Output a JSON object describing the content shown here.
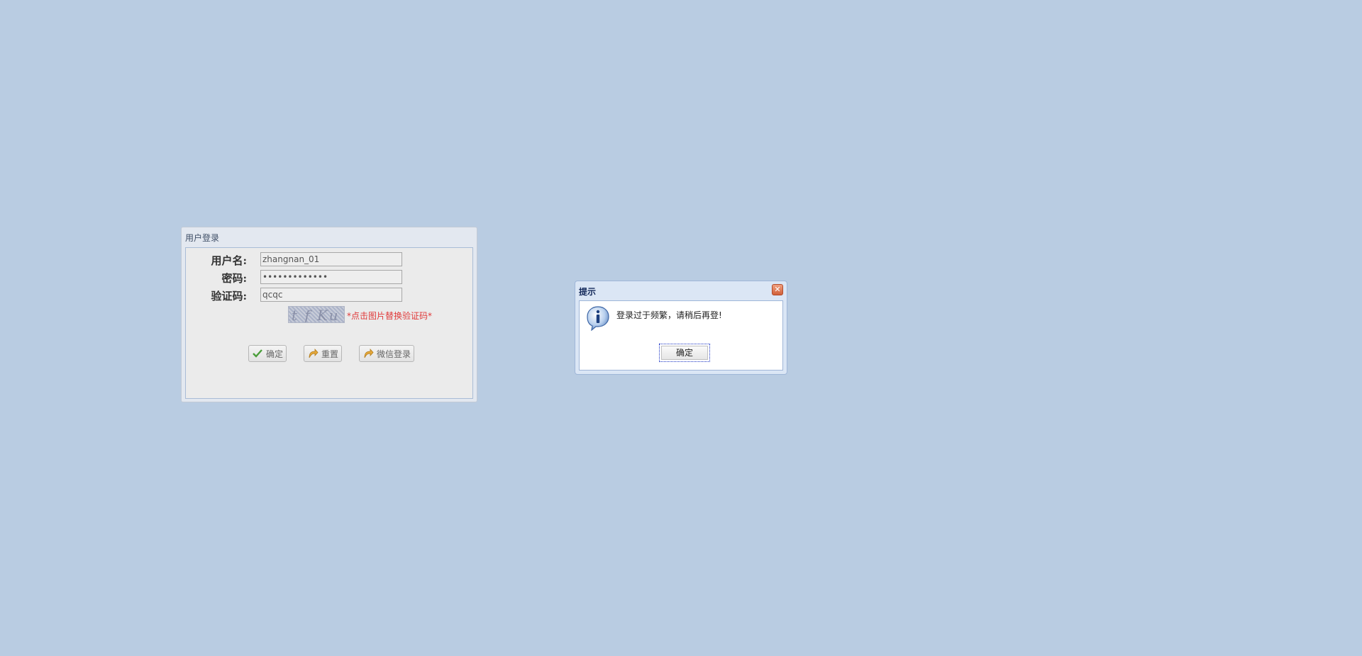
{
  "colors": {
    "background": "#b9cce2",
    "captcha_hint": "#e03a3a",
    "dialog_title": "#14295a"
  },
  "login": {
    "title": "用户登录",
    "username_label": "用户名:",
    "username_value": "zhangnan_01",
    "password_label": "密码:",
    "password_value": "•••••••••••••",
    "captcha_label": "验证码:",
    "captcha_value": "qcqc",
    "captcha_image_text": "t f Ku",
    "captcha_hint": "*点击图片替换验证码*",
    "buttons": {
      "confirm": "确定",
      "reset": "重置",
      "wechat": "微信登录"
    }
  },
  "dialog": {
    "title": "提示",
    "message": "登录过于频繁，请稍后再登!",
    "ok_label": "确定",
    "icon": "info-icon",
    "close_icon": "close-icon"
  }
}
